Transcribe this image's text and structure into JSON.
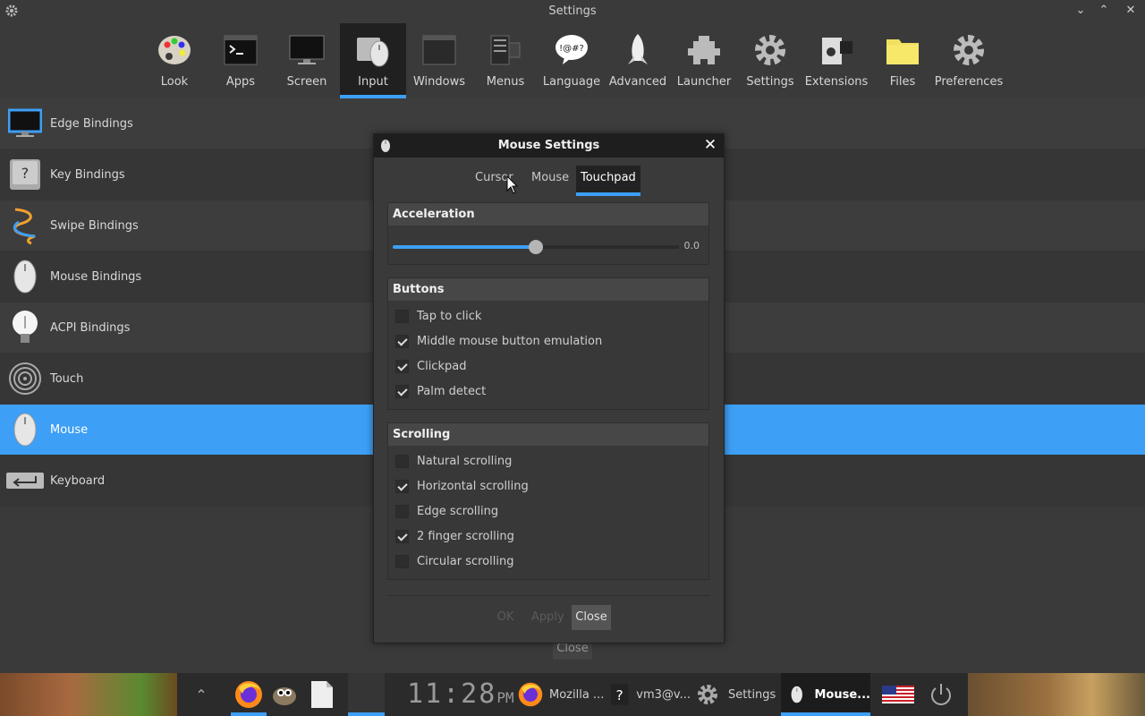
{
  "window": {
    "title": "Settings"
  },
  "toolbar": {
    "items": [
      {
        "label": "Look",
        "icon": "palette-icon"
      },
      {
        "label": "Apps",
        "icon": "terminal-icon"
      },
      {
        "label": "Screen",
        "icon": "monitor-icon"
      },
      {
        "label": "Input",
        "icon": "mouse-icon",
        "active": true
      },
      {
        "label": "Windows",
        "icon": "window-icon"
      },
      {
        "label": "Menus",
        "icon": "menu-icon"
      },
      {
        "label": "Language",
        "icon": "speech-bubble-icon"
      },
      {
        "label": "Advanced",
        "icon": "rocket-icon"
      },
      {
        "label": "Launcher",
        "icon": "puzzle-icon"
      },
      {
        "label": "Settings",
        "icon": "gear-icon"
      },
      {
        "label": "Extensions",
        "icon": "extension-icon"
      },
      {
        "label": "Files",
        "icon": "folder-icon"
      },
      {
        "label": "Preferences",
        "icon": "gear-icon"
      }
    ]
  },
  "sidebar": {
    "items": [
      {
        "label": "Edge Bindings",
        "icon": "monitor-icon"
      },
      {
        "label": "Key Bindings",
        "icon": "key-icon"
      },
      {
        "label": "Swipe Bindings",
        "icon": "swipe-icon"
      },
      {
        "label": "Mouse Bindings",
        "icon": "mouse-icon"
      },
      {
        "label": "ACPI Bindings",
        "icon": "lightbulb-icon"
      },
      {
        "label": "Touch",
        "icon": "fingerprint-icon"
      },
      {
        "label": "Mouse",
        "icon": "mouse-icon",
        "selected": true
      },
      {
        "label": "Keyboard",
        "icon": "enter-key-icon"
      }
    ]
  },
  "bottom_close_label": "Close",
  "dialog": {
    "title": "Mouse Settings",
    "close_glyph": "✕",
    "tabs": [
      {
        "label": "Cursor"
      },
      {
        "label": "Mouse"
      },
      {
        "label": "Touchpad",
        "active": true
      }
    ],
    "acceleration": {
      "title": "Acceleration",
      "value": 0.0,
      "value_label": "0.0",
      "fill_fraction": 0.5
    },
    "buttons": {
      "title": "Buttons",
      "options": [
        {
          "label": "Tap to click",
          "checked": false
        },
        {
          "label": "Middle mouse button emulation",
          "checked": true
        },
        {
          "label": "Clickpad",
          "checked": true
        },
        {
          "label": "Palm detect",
          "checked": true
        }
      ]
    },
    "scrolling": {
      "title": "Scrolling",
      "options": [
        {
          "label": "Natural scrolling",
          "checked": false
        },
        {
          "label": "Horizontal scrolling",
          "checked": true
        },
        {
          "label": "Edge scrolling",
          "checked": false
        },
        {
          "label": "2 finger scrolling",
          "checked": true
        },
        {
          "label": "Circular scrolling",
          "checked": false
        }
      ]
    },
    "footer": {
      "ok_label": "OK",
      "apply_label": "Apply",
      "close_label": "Close"
    }
  },
  "taskbar": {
    "clock": {
      "time": "11:28",
      "ampm": "PM"
    },
    "tasks": [
      {
        "label": "Mozilla ...",
        "icon": "firefox-icon"
      },
      {
        "label": "vm3@v...",
        "icon": "question-icon"
      },
      {
        "label": "Settings",
        "icon": "gear-icon"
      },
      {
        "label": "Mouse...",
        "icon": "mouse-icon",
        "active": true
      }
    ]
  },
  "colors": {
    "accent": "#3d9ff5",
    "background": "#3a3a3a",
    "titlebar": "#1e1e1e"
  }
}
